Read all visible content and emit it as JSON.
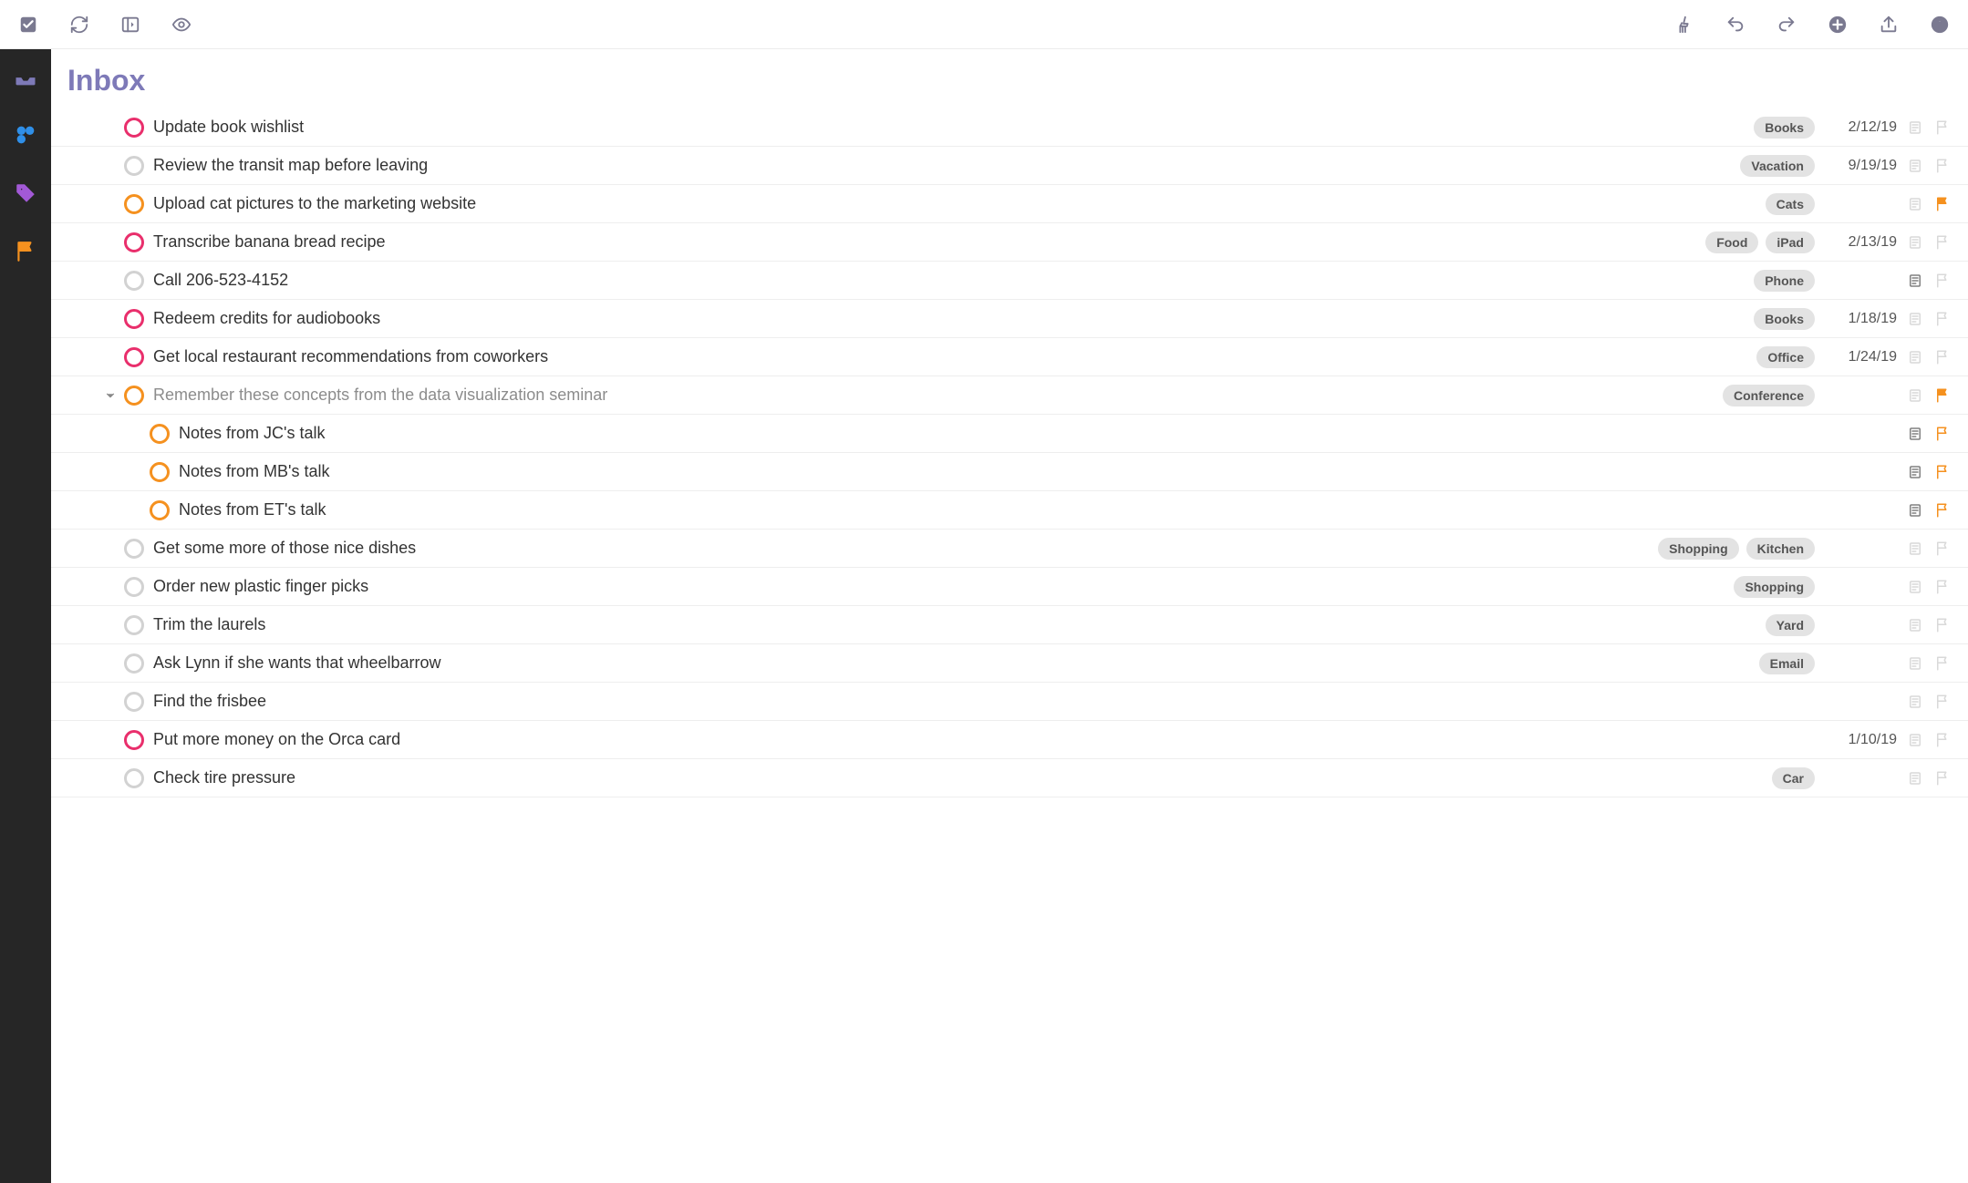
{
  "page_title": "Inbox",
  "toolbar_icons_left": [
    "check",
    "sync",
    "sidebar-toggle",
    "eye"
  ],
  "toolbar_icons_right": [
    "cleanup",
    "undo",
    "redo",
    "add",
    "share",
    "info"
  ],
  "sidebar_items": [
    {
      "name": "inbox",
      "color": "#7e7ab8"
    },
    {
      "name": "projects",
      "color": "#2f8fe8"
    },
    {
      "name": "tags",
      "color": "#a259d6"
    },
    {
      "name": "flagged",
      "color": "#f5911f"
    }
  ],
  "colors": {
    "pink": "#e92f6c",
    "orange": "#f5911f",
    "gray": "#d2d2d2",
    "flag_orange": "#f5911f",
    "icon_muted": "#d9d9d9",
    "icon_dark": "#808080"
  },
  "tasks": [
    {
      "title": "Update book wishlist",
      "circle": "pink",
      "tags": [
        "Books"
      ],
      "date": "2/12/19",
      "note": "muted",
      "flag": "muted"
    },
    {
      "title": "Review the transit map before leaving",
      "circle": "gray",
      "tags": [
        "Vacation"
      ],
      "date": "9/19/19",
      "note": "muted",
      "flag": "muted"
    },
    {
      "title": "Upload cat pictures to the marketing website",
      "circle": "orange",
      "tags": [
        "Cats"
      ],
      "date": "",
      "note": "muted",
      "flag": "orange-solid"
    },
    {
      "title": "Transcribe banana bread recipe",
      "circle": "pink",
      "tags": [
        "Food",
        "iPad"
      ],
      "date": "2/13/19",
      "note": "muted",
      "flag": "muted"
    },
    {
      "title": "Call 206-523-4152",
      "circle": "gray",
      "tags": [
        "Phone"
      ],
      "date": "",
      "note": "dark",
      "flag": "muted"
    },
    {
      "title": "Redeem credits for audiobooks",
      "circle": "pink",
      "tags": [
        "Books"
      ],
      "date": "1/18/19",
      "note": "muted",
      "flag": "muted"
    },
    {
      "title": "Get local restaurant recommendations from coworkers",
      "circle": "pink",
      "tags": [
        "Office"
      ],
      "date": "1/24/19",
      "note": "muted",
      "flag": "muted"
    },
    {
      "title": "Remember these concepts from the data visualization seminar",
      "circle": "orange",
      "tags": [
        "Conference"
      ],
      "date": "",
      "note": "muted",
      "flag": "orange-solid",
      "muted_title": true,
      "has_disclosure": true
    },
    {
      "title": "Notes from JC's talk",
      "circle": "orange",
      "tags": [],
      "date": "",
      "note": "dark",
      "flag": "orange-outline",
      "child": true
    },
    {
      "title": "Notes from MB's talk",
      "circle": "orange",
      "tags": [],
      "date": "",
      "note": "dark",
      "flag": "orange-outline",
      "child": true
    },
    {
      "title": "Notes from ET's talk",
      "circle": "orange",
      "tags": [],
      "date": "",
      "note": "dark",
      "flag": "orange-outline",
      "child": true
    },
    {
      "title": "Get some more of those nice dishes",
      "circle": "gray",
      "tags": [
        "Shopping",
        "Kitchen"
      ],
      "date": "",
      "note": "muted",
      "flag": "muted"
    },
    {
      "title": "Order new plastic finger picks",
      "circle": "gray",
      "tags": [
        "Shopping"
      ],
      "date": "",
      "note": "muted",
      "flag": "muted"
    },
    {
      "title": "Trim the laurels",
      "circle": "gray",
      "tags": [
        "Yard"
      ],
      "date": "",
      "note": "muted",
      "flag": "muted"
    },
    {
      "title": "Ask Lynn if she wants that wheelbarrow",
      "circle": "gray",
      "tags": [
        "Email"
      ],
      "date": "",
      "note": "muted",
      "flag": "muted"
    },
    {
      "title": "Find the frisbee",
      "circle": "gray",
      "tags": [],
      "date": "",
      "note": "muted",
      "flag": "muted"
    },
    {
      "title": "Put more money on the Orca card",
      "circle": "pink",
      "tags": [],
      "date": "1/10/19",
      "note": "muted",
      "flag": "muted"
    },
    {
      "title": "Check tire pressure",
      "circle": "gray",
      "tags": [
        "Car"
      ],
      "date": "",
      "note": "muted",
      "flag": "muted"
    }
  ]
}
